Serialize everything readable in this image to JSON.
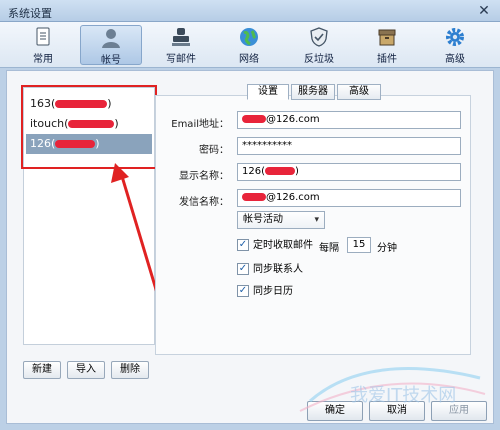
{
  "window": {
    "title": "系统设置",
    "close_glyph": "✕"
  },
  "toolbar": [
    {
      "label": "常用",
      "icon": "doc-icon"
    },
    {
      "label": "帐号",
      "icon": "user-icon",
      "active": true
    },
    {
      "label": "写邮件",
      "icon": "stamp-icon"
    },
    {
      "label": "网络",
      "icon": "globe-icon"
    },
    {
      "label": "反垃圾",
      "icon": "shield-icon"
    },
    {
      "label": "插件",
      "icon": "box-icon"
    },
    {
      "label": "高级",
      "icon": "gear-icon"
    }
  ],
  "accounts": [
    {
      "label": "163(",
      "redacted": true
    },
    {
      "label": "itouch(",
      "redacted": true
    },
    {
      "label": "126(",
      "redacted": true,
      "selected": true
    }
  ],
  "list_buttons": {
    "new": "新建",
    "import": "导入",
    "delete": "删除"
  },
  "tabs": {
    "settings": "设置",
    "server": "服务器",
    "advanced": "高级"
  },
  "form": {
    "email_label": "Email地址：",
    "email_value": "@126.com",
    "password_label": "密码：",
    "password_value": "**********",
    "display_label": "显示名称：",
    "display_value": "126(",
    "sender_label": "发信名称：",
    "sender_value": "@126.com",
    "status_select": "帐号活动",
    "auto_fetch_label": "定时收取邮件",
    "every_label": "每隔",
    "interval_value": "15",
    "minutes_label": "分钟",
    "sync_contacts_label": "同步联系人",
    "sync_calendar_label": "同步日历",
    "check_glyph": "✓"
  },
  "footer": {
    "ok": "确定",
    "cancel": "取消",
    "apply": "应用"
  },
  "colors": {
    "annotation_red": "#e02222",
    "selected_row": "#8aa3bc",
    "accent_blue": "#1e5fa8"
  }
}
